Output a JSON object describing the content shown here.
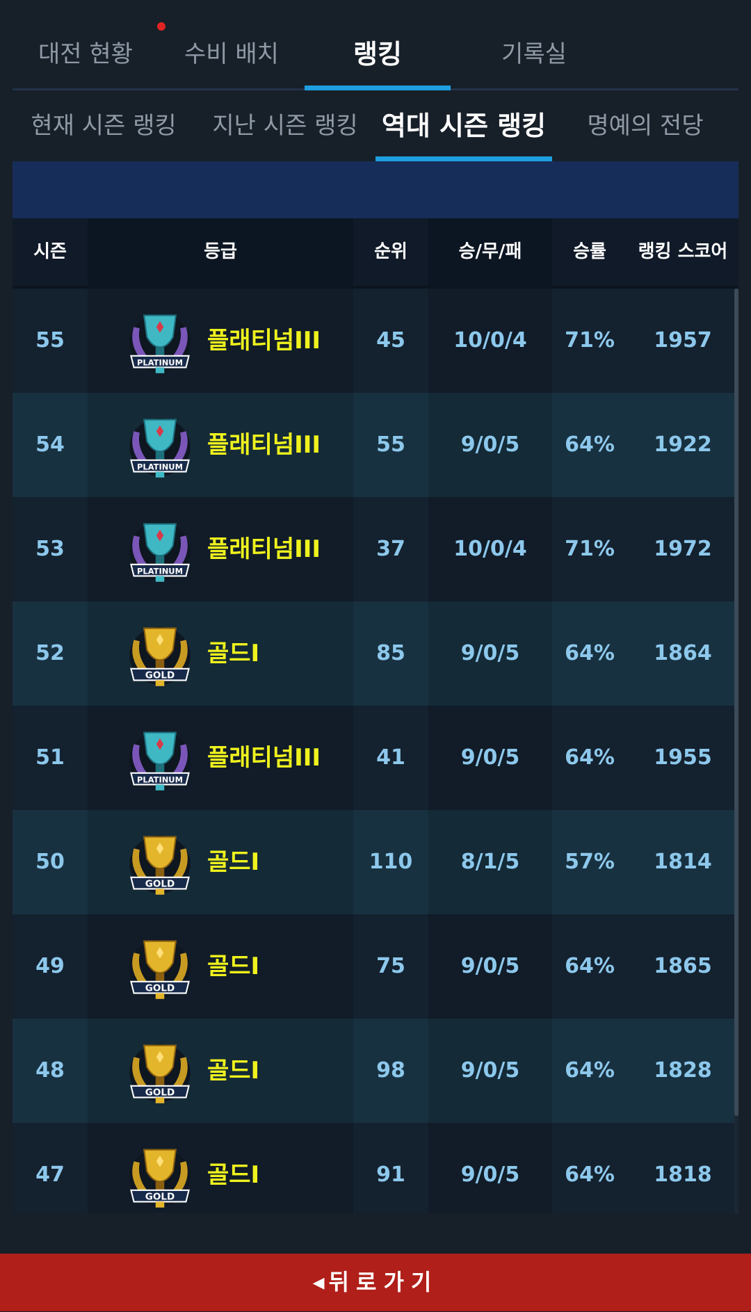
{
  "main_tabs": [
    {
      "label": "대전 현황",
      "active": false
    },
    {
      "label": "수비 배치",
      "active": false
    },
    {
      "label": "랭킹",
      "active": true
    },
    {
      "label": "기록실",
      "active": false
    }
  ],
  "sub_tabs": [
    {
      "label": "현재 시즌 랭킹",
      "active": false
    },
    {
      "label": "지난 시즌 랭킹",
      "active": false
    },
    {
      "label": "역대 시즌 랭킹",
      "active": true
    },
    {
      "label": "명예의 전당",
      "active": false
    }
  ],
  "table": {
    "headers": {
      "season": "시즌",
      "tier": "등급",
      "rank": "순위",
      "record": "승/무/패",
      "win_rate": "승률",
      "score": "랭킹 스코어"
    },
    "rows": [
      {
        "season": "55",
        "emblem": "platinum",
        "emblem_text": "PLATINUM",
        "tier": "플래티넘III",
        "rank": "45",
        "record": "10/0/4",
        "win_rate": "71%",
        "score": "1957"
      },
      {
        "season": "54",
        "emblem": "platinum",
        "emblem_text": "PLATINUM",
        "tier": "플래티넘III",
        "rank": "55",
        "record": "9/0/5",
        "win_rate": "64%",
        "score": "1922"
      },
      {
        "season": "53",
        "emblem": "platinum",
        "emblem_text": "PLATINUM",
        "tier": "플래티넘III",
        "rank": "37",
        "record": "10/0/4",
        "win_rate": "71%",
        "score": "1972"
      },
      {
        "season": "52",
        "emblem": "gold",
        "emblem_text": "GOLD",
        "tier": "골드I",
        "rank": "85",
        "record": "9/0/5",
        "win_rate": "64%",
        "score": "1864"
      },
      {
        "season": "51",
        "emblem": "platinum",
        "emblem_text": "PLATINUM",
        "tier": "플래티넘III",
        "rank": "41",
        "record": "9/0/5",
        "win_rate": "64%",
        "score": "1955"
      },
      {
        "season": "50",
        "emblem": "gold",
        "emblem_text": "GOLD",
        "tier": "골드I",
        "rank": "110",
        "record": "8/1/5",
        "win_rate": "57%",
        "score": "1814"
      },
      {
        "season": "49",
        "emblem": "gold",
        "emblem_text": "GOLD",
        "tier": "골드I",
        "rank": "75",
        "record": "9/0/5",
        "win_rate": "64%",
        "score": "1865"
      },
      {
        "season": "48",
        "emblem": "gold",
        "emblem_text": "GOLD",
        "tier": "골드I",
        "rank": "98",
        "record": "9/0/5",
        "win_rate": "64%",
        "score": "1828"
      },
      {
        "season": "47",
        "emblem": "gold",
        "emblem_text": "GOLD",
        "tier": "골드I",
        "rank": "91",
        "record": "9/0/5",
        "win_rate": "64%",
        "score": "1818"
      }
    ]
  },
  "back_button": {
    "label": "뒤로가기",
    "icon": "arrow-left-icon"
  },
  "colors": {
    "accent": "#1e9fe0",
    "tier_text": "#eff21d",
    "value_text": "#8dc8ec",
    "back_button": "#b01f19"
  }
}
